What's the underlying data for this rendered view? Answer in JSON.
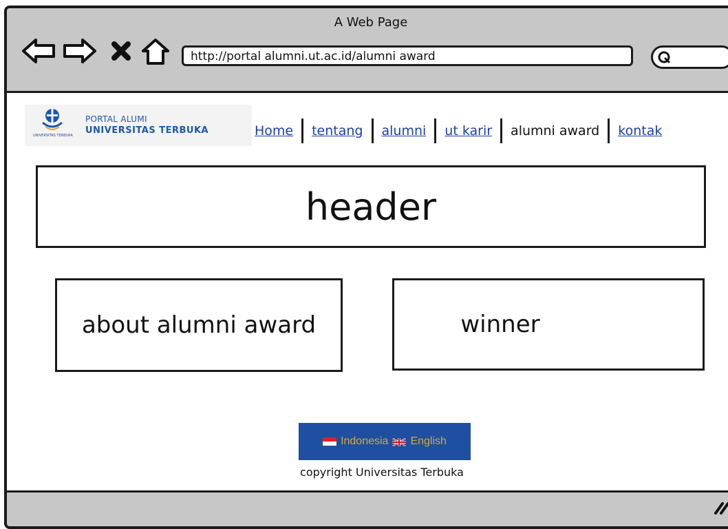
{
  "window": {
    "title": "A Web Page"
  },
  "toolbar": {
    "url": "http://portal alumni.ut.ac.id/alumni award",
    "icons": [
      "back-icon",
      "forward-icon",
      "close-icon",
      "home-icon",
      "search-icon"
    ]
  },
  "logo": {
    "line1": "PORTAL ALUMI",
    "line2": "UNIVERSITAS TERBUKA",
    "tiny": "UNIVERSITAS TERBUKA"
  },
  "nav": {
    "items": [
      {
        "label": "Home",
        "link": true
      },
      {
        "label": "tentang",
        "link": true
      },
      {
        "label": "alumni",
        "link": true
      },
      {
        "label": "ut karir",
        "link": true
      },
      {
        "label": "alumni award",
        "link": false
      },
      {
        "label": "kontak",
        "link": true
      }
    ]
  },
  "main": {
    "header": "header",
    "about": "about alumni award",
    "winner": "winner"
  },
  "footer": {
    "lang_id": "Indonesia",
    "lang_en": "English",
    "copyright": "copyright Universitas Terbuka"
  },
  "colors": {
    "chrome": "#c7c7c7",
    "link": "#1a3fa8",
    "lang_bg": "#1f4fa0",
    "lang_text": "#d7a93a",
    "brand": "#1a58b0"
  }
}
